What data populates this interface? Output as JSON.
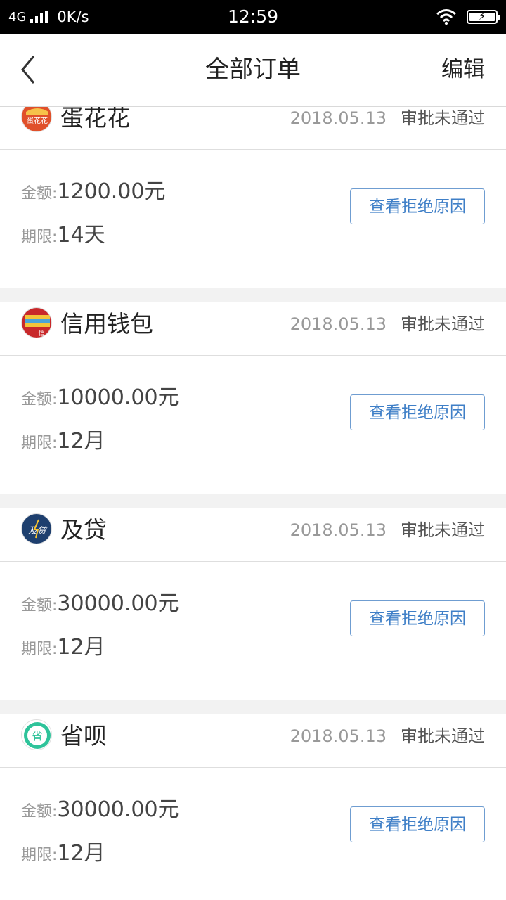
{
  "status_bar": {
    "network": "4G",
    "speed": "0K/s",
    "time": "12:59"
  },
  "header": {
    "title": "全部订单",
    "edit_label": "编辑"
  },
  "labels": {
    "amount": "金额:",
    "term": "期限:"
  },
  "orders": [
    {
      "name": "蛋花花",
      "logo_text": "蛋花花",
      "date": "2018.05.13",
      "status": "审批未通过",
      "amount": "1200.00元",
      "term": "14天",
      "button": "查看拒绝原因"
    },
    {
      "name": "信用钱包",
      "logo_text": "信",
      "date": "2018.05.13",
      "status": "审批未通过",
      "amount": "10000.00元",
      "term": "12月",
      "button": "查看拒绝原因"
    },
    {
      "name": "及贷",
      "logo_text": "及贷",
      "date": "2018.05.13",
      "status": "审批未通过",
      "amount": "30000.00元",
      "term": "12月",
      "button": "查看拒绝原因"
    },
    {
      "name": "省呗",
      "logo_text": "省",
      "date": "2018.05.13",
      "status": "审批未通过",
      "amount": "30000.00元",
      "term": "12月",
      "button": "查看拒绝原因"
    }
  ],
  "colors": {
    "accent": "#3f7fc7",
    "background": "#f2f2f2"
  }
}
